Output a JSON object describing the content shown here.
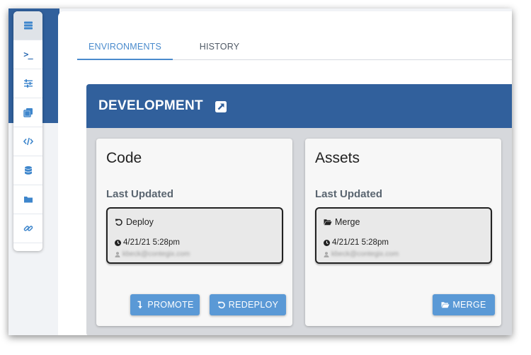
{
  "sidebar": {
    "items": [
      {
        "icon": "server-icon",
        "active": true
      },
      {
        "icon": "terminal-icon",
        "text": ">_"
      },
      {
        "icon": "sliders-icon"
      },
      {
        "icon": "copy-icon"
      },
      {
        "icon": "code-icon"
      },
      {
        "icon": "database-icon"
      },
      {
        "icon": "folder-icon"
      },
      {
        "icon": "link-icon"
      }
    ]
  },
  "tabs": [
    {
      "label": "ENVIRONMENTS",
      "active": true
    },
    {
      "label": "HISTORY",
      "active": false
    }
  ],
  "environment": {
    "title": "DEVELOPMENT",
    "cards": [
      {
        "title": "Code",
        "last_updated_label": "Last Updated",
        "action": "Deploy",
        "action_icon": "undo-icon",
        "datetime": "4/21/21 5:28pm",
        "user": "kbeck@contegix.com",
        "buttons": [
          {
            "label": "PROMOTE",
            "icon": "level-down-icon"
          },
          {
            "label": "REDEPLOY",
            "icon": "undo-icon"
          }
        ]
      },
      {
        "title": "Assets",
        "last_updated_label": "Last Updated",
        "action": "Merge",
        "action_icon": "folder-open-icon",
        "datetime": "4/21/21 5:28pm",
        "user": "kbeck@contegix.com",
        "buttons": [
          {
            "label": "MERGE",
            "icon": "folder-open-icon"
          }
        ]
      }
    ]
  },
  "colors": {
    "primary": "#31609c",
    "accent": "#4a8bcd",
    "button": "#5a99d6"
  }
}
